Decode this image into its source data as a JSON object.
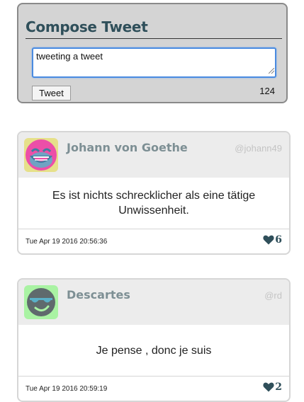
{
  "compose": {
    "title": "Compose Tweet",
    "input_value": "tweeting a tweet",
    "button_label": "Tweet",
    "remaining_chars": "124"
  },
  "tweets": [
    {
      "author": "Johann von Goethe",
      "handle": "@johann49",
      "text": "Es ist nichts schrecklicher als eine tätige Unwissenheit.",
      "timestamp": "Tue Apr 19 2016 20:56:36",
      "likes": "6",
      "avatar_icon": "smiling-face-icon",
      "avatar_bg": "#e6e08a",
      "avatar_face": "#ec4fa8"
    },
    {
      "author": "Descartes",
      "handle": "@rd",
      "text": "Je pense , donc je suis",
      "timestamp": "Tue Apr 19 2016 20:59:19",
      "likes": "2",
      "avatar_icon": "sunglasses-face-icon",
      "avatar_bg": "#a9f3a3",
      "avatar_face": "#5f6a6d"
    }
  ],
  "colors": {
    "accent": "#2f4f5a",
    "compose_bg": "#d4d4d4",
    "header_bg": "#ececec",
    "input_focus": "#4a8be0"
  }
}
